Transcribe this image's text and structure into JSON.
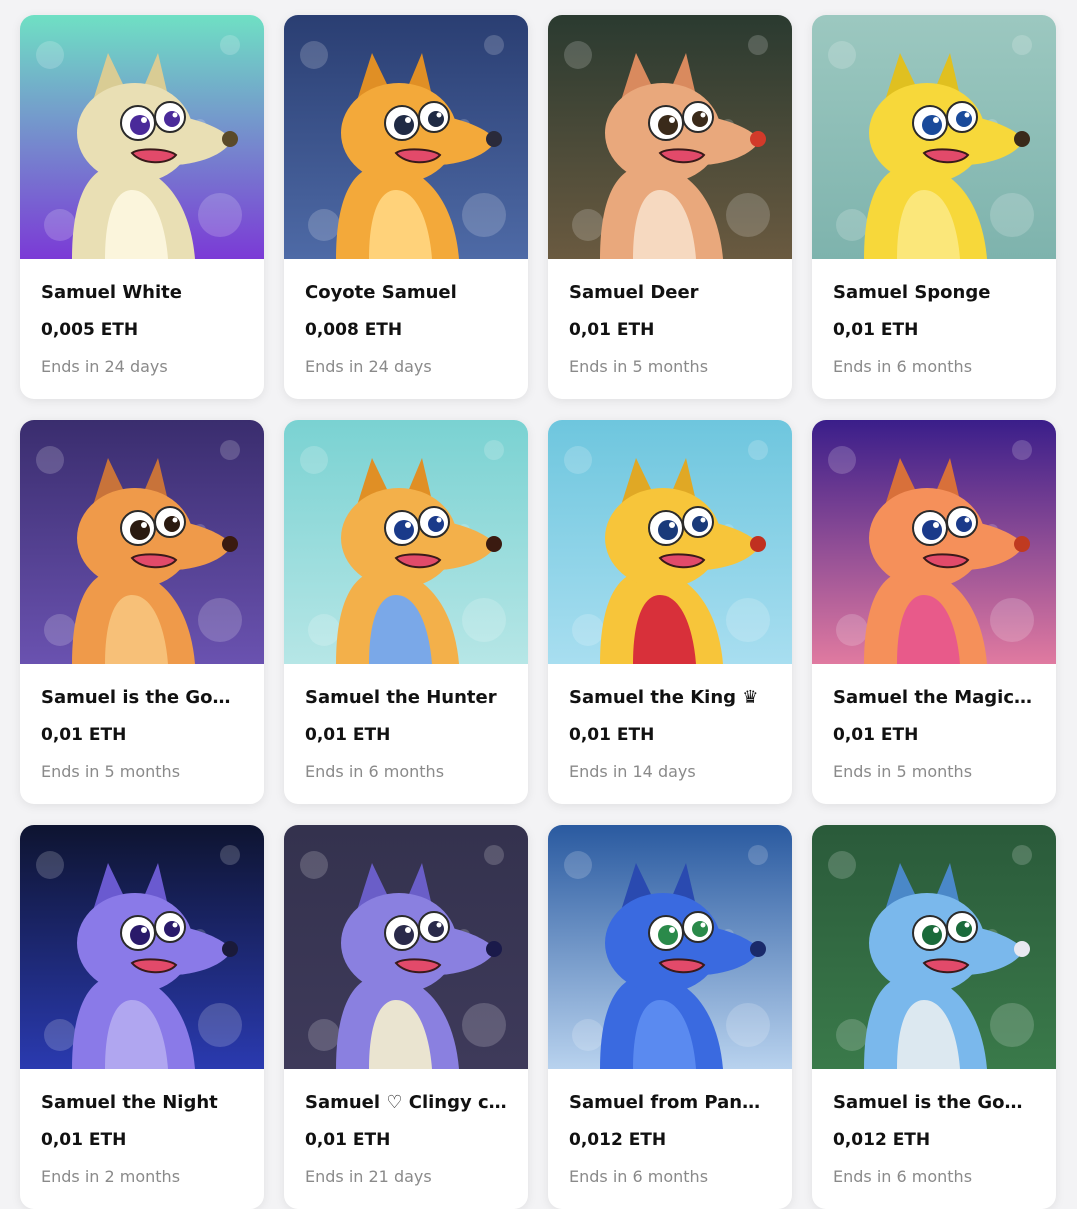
{
  "cards": [
    {
      "title": "Samuel White",
      "price": "0,005 ETH",
      "ends": "Ends in 24 days",
      "colors": {
        "bg1": "#6fe0c4",
        "bg2": "#7b3ad6",
        "fur": "#e9dfb4",
        "belly": "#fbf5dc",
        "ear": "#d9cc94",
        "eye": "#4a2a9a",
        "nose": "#5a4a2a"
      }
    },
    {
      "title": "Coyote Samuel",
      "price": "0,008 ETH",
      "ends": "Ends in 24 days",
      "colors": {
        "bg1": "#2a3e72",
        "bg2": "#4e6aa6",
        "fur": "#f3a93a",
        "belly": "#ffd27a",
        "ear": "#e08f25",
        "eye": "#1f2a44",
        "nose": "#2a2a3a"
      }
    },
    {
      "title": "Samuel Deer",
      "price": "0,01 ETH",
      "ends": "Ends in 5 months",
      "colors": {
        "bg1": "#2a3a30",
        "bg2": "#6a5a40",
        "fur": "#e9a87c",
        "belly": "#f6d9c0",
        "ear": "#d98a5e",
        "eye": "#3a2a1a",
        "nose": "#d23a2a"
      }
    },
    {
      "title": "Samuel Sponge",
      "price": "0,01 ETH",
      "ends": "Ends in 6 months",
      "colors": {
        "bg1": "#9cc8c0",
        "bg2": "#7eb3ad",
        "fur": "#f7d83a",
        "belly": "#fbe77a",
        "ear": "#e0c020",
        "eye": "#1a4a9a",
        "nose": "#3a2a1a"
      }
    },
    {
      "title": "Samuel is the God of…",
      "price": "0,01 ETH",
      "ends": "Ends in 5 months",
      "colors": {
        "bg1": "#3a2d6e",
        "bg2": "#6a52b0",
        "fur": "#ef9a4a",
        "belly": "#f7c078",
        "ear": "#c8733a",
        "eye": "#2a1a10",
        "nose": "#3a1a10"
      }
    },
    {
      "title": "Samuel the Hunter",
      "price": "0,01 ETH",
      "ends": "Ends in 6 months",
      "colors": {
        "bg1": "#7ad2d2",
        "bg2": "#b6e6e6",
        "fur": "#f3b04a",
        "belly": "#7aa8e8",
        "ear": "#e08f25",
        "eye": "#1a3a8a",
        "nose": "#3a1a10"
      }
    },
    {
      "title": "Samuel the King ♛",
      "price": "0,01 ETH",
      "ends": "Ends in 14 days",
      "colors": {
        "bg1": "#6ec6de",
        "bg2": "#a8def0",
        "fur": "#f7c53a",
        "belly": "#d8303a",
        "ear": "#e0a825",
        "eye": "#1a3a7a",
        "nose": "#c03020"
      }
    },
    {
      "title": "Samuel the Magician",
      "price": "0,01 ETH",
      "ends": "Ends in 5 months",
      "colors": {
        "bg1": "#3a1e8a",
        "bg2": "#e07aa0",
        "fur": "#f5905a",
        "belly": "#e85a8a",
        "ear": "#d8703a",
        "eye": "#1a3a8a",
        "nose": "#c03a20"
      }
    },
    {
      "title": "Samuel the Night",
      "price": "0,01 ETH",
      "ends": "Ends in 2 months",
      "colors": {
        "bg1": "#0e1430",
        "bg2": "#2a3ab0",
        "fur": "#8a7ae8",
        "belly": "#b0a6f0",
        "ear": "#6a5ad0",
        "eye": "#2a1a6a",
        "nose": "#1a1a3a"
      }
    },
    {
      "title": "Samuel ♡ Clingy cat",
      "price": "0,01 ETH",
      "ends": "Ends in 21 days",
      "colors": {
        "bg1": "#34324e",
        "bg2": "#3e3a5a",
        "fur": "#8a80e0",
        "belly": "#eae4d0",
        "ear": "#6a5ec8",
        "eye": "#2a2a4a",
        "nose": "#1a1a4a"
      }
    },
    {
      "title": "Samuel from Pandora",
      "price": "0,012 ETH",
      "ends": "Ends in 6 months",
      "colors": {
        "bg1": "#2a5aa0",
        "bg2": "#b8d2ee",
        "fur": "#3a6ae0",
        "belly": "#5a8af0",
        "ear": "#2a4ab0",
        "eye": "#2a8a4a",
        "nose": "#1a2a6a"
      }
    },
    {
      "title": "Samuel is the God of…",
      "price": "0,012 ETH",
      "ends": "Ends in 6 months",
      "colors": {
        "bg1": "#2a5a3a",
        "bg2": "#3a7a4a",
        "fur": "#7ab8ec",
        "belly": "#dce8f0",
        "ear": "#4a88c8",
        "eye": "#1a6a3a",
        "nose": "#e8e8f0"
      }
    }
  ]
}
